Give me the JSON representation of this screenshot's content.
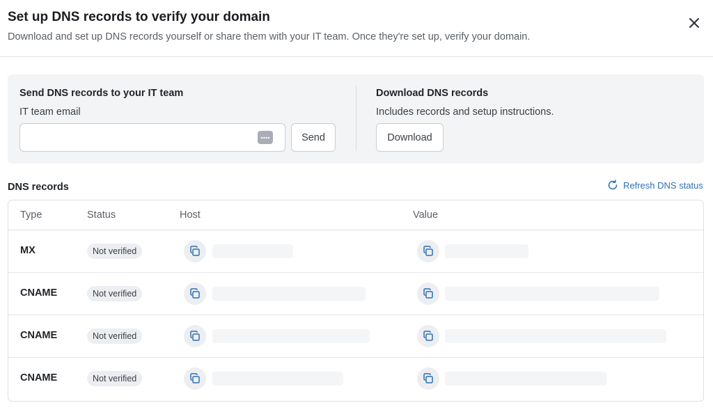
{
  "dialog": {
    "title": "Set up DNS records to verify your domain",
    "subtitle": "Download and set up DNS records yourself or share them with your IT team. Once they're set up, verify your domain."
  },
  "send_section": {
    "title": "Send DNS records to your IT team",
    "email_label": "IT team email",
    "email_value": "",
    "send_label": "Send"
  },
  "download_section": {
    "title": "Download DNS records",
    "description": "Includes records and setup instructions.",
    "download_label": "Download"
  },
  "records": {
    "title": "DNS records",
    "refresh_label": "Refresh DNS status",
    "columns": [
      "Type",
      "Status",
      "Host",
      "Value"
    ],
    "rows": [
      {
        "type": "MX",
        "status": "Not verified"
      },
      {
        "type": "CNAME",
        "status": "Not verified"
      },
      {
        "type": "CNAME",
        "status": "Not verified"
      },
      {
        "type": "CNAME",
        "status": "Not verified"
      }
    ]
  },
  "icons": {
    "close": "close-icon",
    "password_manager": "password-manager-icon",
    "refresh": "refresh-icon",
    "copy": "copy-icon"
  },
  "colors": {
    "link": "#2f6fb3",
    "panel_bg": "#f3f4f6",
    "badge_bg": "#eceef1"
  }
}
